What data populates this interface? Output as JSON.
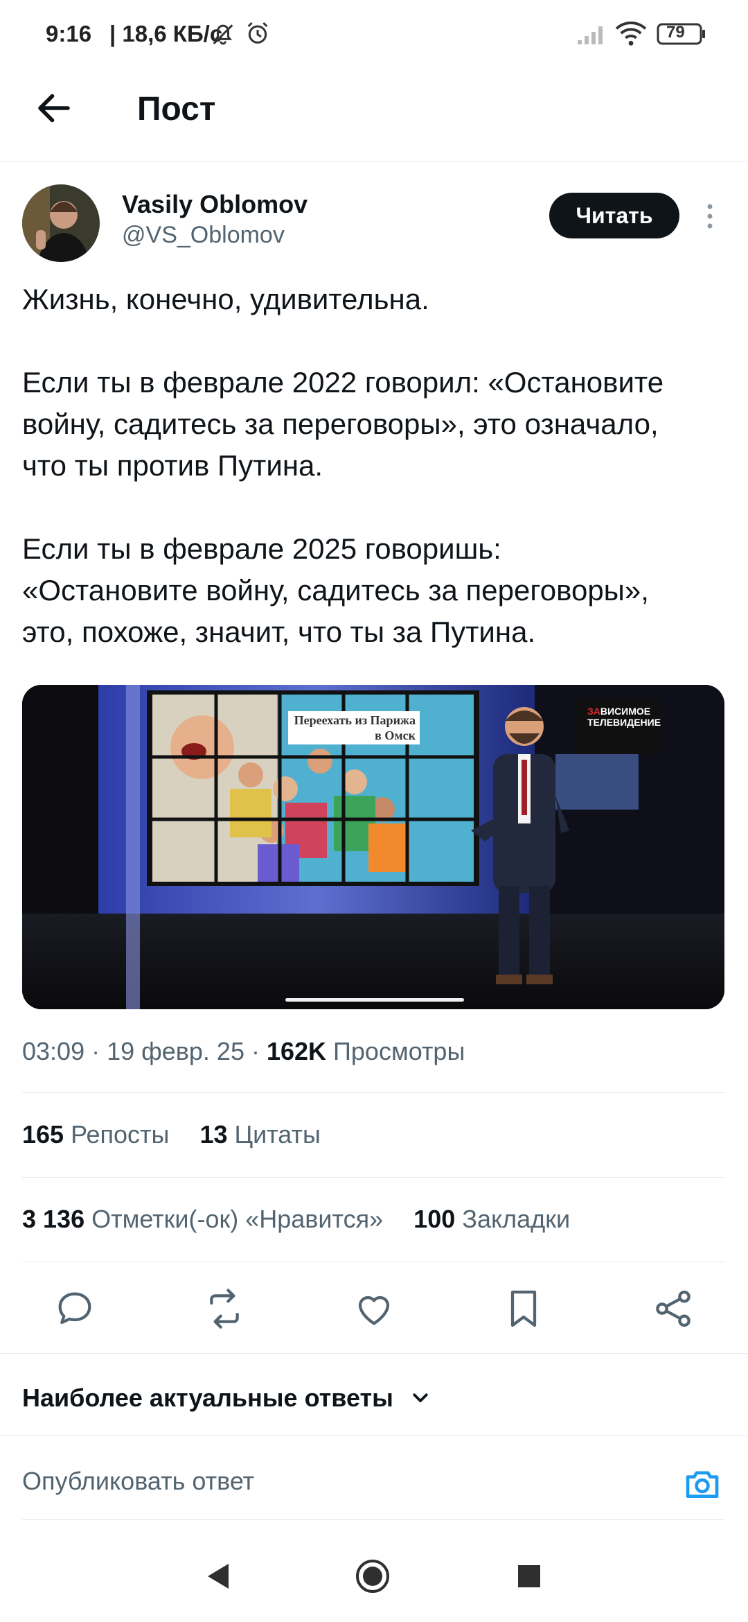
{
  "status_bar": {
    "time": "9:16",
    "speed": "| 18,6 КБ/с",
    "battery": "79"
  },
  "header": {
    "title": "Пост"
  },
  "post": {
    "author_name": "Vasily Oblomov",
    "author_handle": "@VS_Oblomov",
    "follow_label": "Читать",
    "text": {
      "p1": "Жизнь, конечно, удивительна.",
      "p2_l1": "Если ты в феврале 2022 говорил: «Остановите",
      "p2_l2": "войну, садитесь за переговоры», это означало,",
      "p2_l3": "что ты против Путина.",
      "p3_l1": "Если ты в феврале 2025 говоришь:",
      "p3_l2": "«Остановите войну, садитесь за переговоры»,",
      "p3_l3": "это, похоже, значит, что ты за Путина."
    },
    "media": {
      "screen_caption_l1": "Переехать из Парижа",
      "screen_caption_l2": "в Омск",
      "logo_l1": "ЗАВИСИМОЕ",
      "logo_l2": "ТЕЛЕВИДЕНИЕ",
      "progress": 0.0
    },
    "meta": {
      "timestamp": "03:09 · 19 февр. 25 · ",
      "views_count": "162K",
      "views_label": "Просмотры"
    },
    "stats": {
      "reposts_count": "165",
      "reposts_label": "Репосты",
      "quotes_count": "13",
      "quotes_label": "Цитаты",
      "likes_count": "3 136",
      "likes_label": "Отметки(-ок) «Нравится»",
      "bookmarks_count": "100",
      "bookmarks_label": "Закладки"
    }
  },
  "replies": {
    "sort_label": "Наиболее актуальные ответы",
    "reply_placeholder": "Опубликовать ответ"
  },
  "colors": {
    "accent": "#1d9bf0",
    "text": "#0f1419",
    "muted": "#536471"
  }
}
